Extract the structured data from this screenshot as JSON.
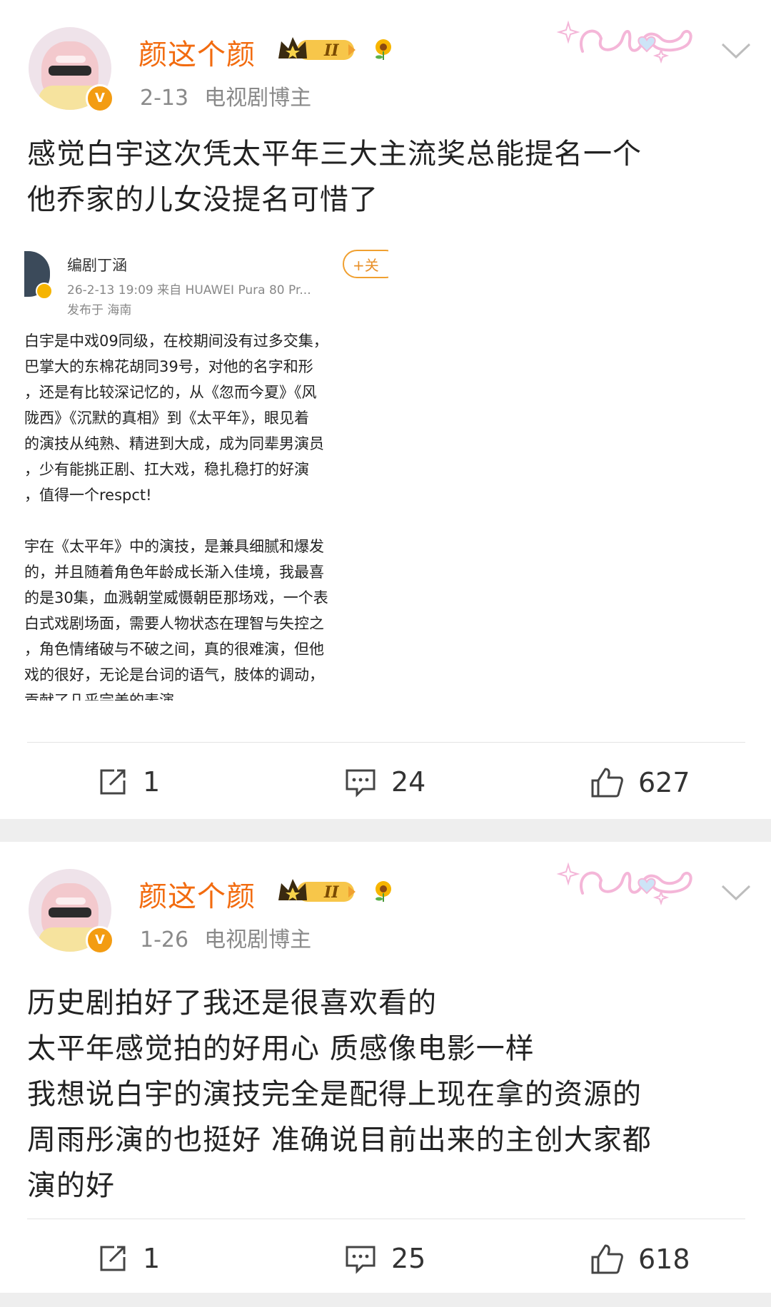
{
  "posts": [
    {
      "author": "颜这个颜",
      "time": "2-13",
      "tag": "电视剧博主",
      "verified_mark": "V",
      "content_lines": [
        "感觉白宇这次凭太平年三大主流奖总能提名一个",
        "他乔家的儿女没提名可惜了"
      ],
      "embedded": {
        "author": "编剧丁涵",
        "meta": "26-2-13 19:09  来自 HUAWEI Pura 80 Pr...",
        "location": "发布于 海南",
        "follow_label": "+关",
        "body_lines": [
          "白宇是中戏09同级，在校期间没有过多交集，",
          "巴掌大的东棉花胡同39号，对他的名字和形",
          "，还是有比较深记忆的，从《忽而今夏》《风",
          "陇西》《沉默的真相》到《太平年》，眼见着",
          "的演技从纯熟、精进到大成，成为同辈男演员",
          "，少有能挑正剧、扛大戏，稳扎稳打的好演",
          "，值得一个respct!",
          "",
          "宇在《太平年》中的演技，是兼具细腻和爆发",
          "的，并且随着角色年龄成长渐入佳境，我最喜",
          "的是30集，血溅朝堂威慑朝臣那场戏，一个表",
          "白式戏剧场面，需要人物状态在理智与失控之",
          "，角色情绪破与不破之间，真的很难演，但他",
          "戏的很好，无论是台词的语气，肢体的调动，",
          "贡献了几乎完美的表演......"
        ]
      },
      "actions": {
        "repost": "1",
        "comment": "24",
        "like": "627"
      }
    },
    {
      "author": "颜这个颜",
      "time": "1-26",
      "tag": "电视剧博主",
      "verified_mark": "V",
      "content_lines": [
        "历史剧拍好了我还是很喜欢看的",
        "太平年感觉拍的好用心 质感像电影一样",
        "我想说白宇的演技完全是配得上现在拿的资源的",
        "周雨彤演的也挺好 准确说目前出来的主创大家都",
        "演的好"
      ],
      "actions": {
        "repost": "1",
        "comment": "25",
        "like": "618"
      }
    }
  ],
  "badge": {
    "level": "II"
  },
  "colors": {
    "name": "#f26b0f",
    "meta": "#8a8a8a",
    "badge": "#f39c12",
    "love": "#f4b6d8"
  },
  "icons": [
    "chevron-down-icon",
    "repost-icon",
    "comment-icon",
    "like-icon",
    "crown-badge-icon",
    "sunflower-icon",
    "love-decoration-icon"
  ]
}
